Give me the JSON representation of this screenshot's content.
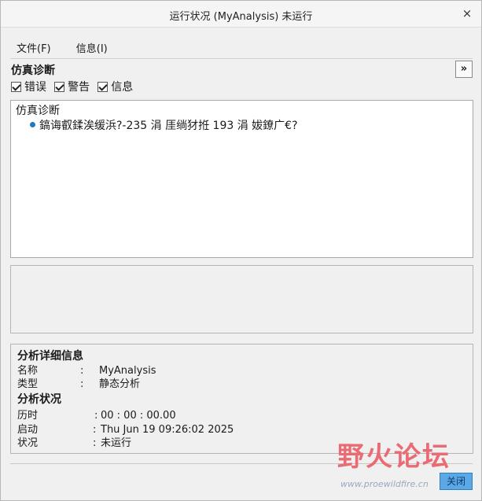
{
  "window": {
    "title": "运行状况 (MyAnalysis) 未运行",
    "close_glyph": "×"
  },
  "menu": {
    "items": [
      "文件(F)",
      "信息(I)"
    ]
  },
  "diagnostics": {
    "title": "仿真诊断",
    "collapse_glyph": "»",
    "filters": [
      {
        "label": "错误",
        "checked": true
      },
      {
        "label": "警告",
        "checked": true
      },
      {
        "label": "信息",
        "checked": true
      }
    ],
    "tree": {
      "root": "仿真诊断",
      "child": "鎬诲叡鍒涘缓浜?-235 涓    厓绱犲拰 193 涓    妭鐐广€?"
    }
  },
  "analysis_details": {
    "heading": "分析详细信息",
    "rows": [
      {
        "label": "名称",
        "colon": ":",
        "value": "MyAnalysis"
      },
      {
        "label": "类型",
        "colon": ":",
        "value": "静态分析"
      }
    ]
  },
  "analysis_status": {
    "heading": "分析状况",
    "rows": [
      {
        "label": "历时",
        "colon": ":",
        "value": "00 : 00 : 00.00"
      },
      {
        "label": "启动",
        "colon": ":",
        "value": "Thu Jun 19 09:26:02 2025"
      },
      {
        "label": "状况",
        "colon": ":",
        "value": "未运行"
      }
    ]
  },
  "footer": {
    "close_label": "关闭"
  },
  "watermark": {
    "main": "野火论坛",
    "url": "www.proewildfire.cn"
  },
  "colors": {
    "accent_button": "#5aa9e6",
    "bullet": "#1f7bbf",
    "watermark": "#ea6b73"
  }
}
